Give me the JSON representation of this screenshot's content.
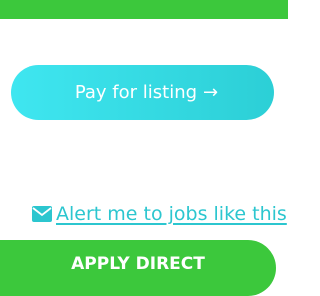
{
  "header": {
    "bar_color": "#3cc83c"
  },
  "pay": {
    "label": "Pay for listing",
    "arrow": "→"
  },
  "alert": {
    "label": "Alert me to jobs like this",
    "icon": "envelope-icon"
  },
  "apply": {
    "label": "APPLY DIRECT"
  },
  "colors": {
    "green": "#3cc83c",
    "teal": "#2cc6cf",
    "cyan_start": "#3fe6f0"
  }
}
